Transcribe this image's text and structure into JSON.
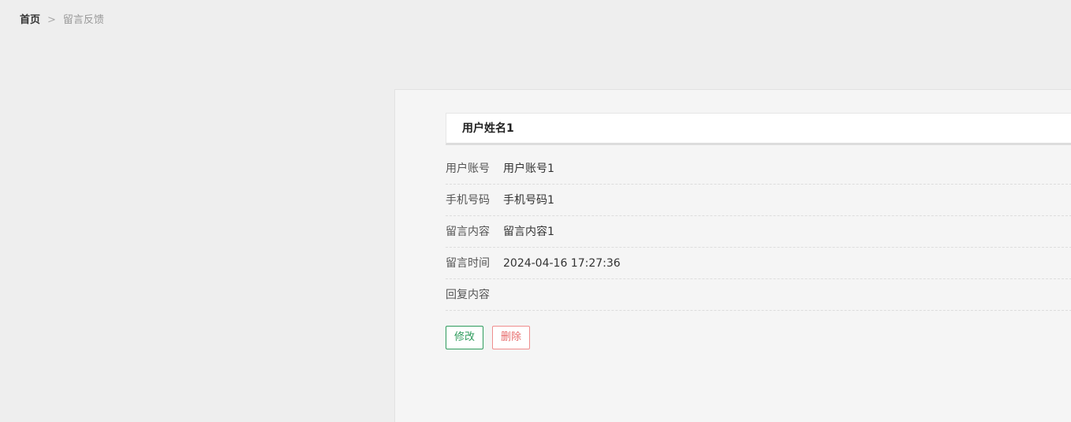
{
  "breadcrumb": {
    "home": "首页",
    "separator": ">",
    "current": "留言反馈"
  },
  "message": {
    "user_name": "用户姓名1",
    "fields": [
      {
        "label": "用户账号",
        "value": "用户账号1"
      },
      {
        "label": "手机号码",
        "value": "手机号码1"
      },
      {
        "label": "留言内容",
        "value": "留言内容1"
      },
      {
        "label": "留言时间",
        "value": "2024-04-16 17:27:36"
      },
      {
        "label": "回复内容",
        "value": ""
      }
    ]
  },
  "actions": {
    "edit_label": "修改",
    "delete_label": "删除"
  },
  "colors": {
    "edit": "#2e9b5c",
    "delete": "#e76b6b"
  }
}
